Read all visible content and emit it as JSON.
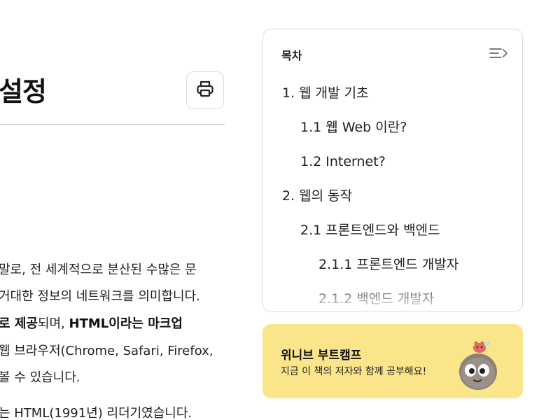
{
  "article": {
    "title": "설정",
    "print_icon": "printer-icon",
    "paragraph_lines": [
      "말로, 전 세계적으로 분산된 수많은 문",
      "거대한 정보의 네트워크를 의미합니다.",
      "로 제공",
      "되며, ",
      "HTML이라는 마크업",
      "웹 브라우저(Chrome, Safari, Firefox,",
      "볼 수 있습니다.",
      "는 HTML(1991년) 리더기였습니다."
    ]
  },
  "toc": {
    "title": "목차",
    "collapse_icon": "toc-collapse-icon",
    "items": [
      "1. 웹 개발 기초",
      "1.1 웹 Web 이란?",
      "1.2 Internet?",
      "2. 웹의 동작",
      "2.1 프론트엔드와 백엔드",
      "2.1.1 프론트엔드 개발자",
      "2.1.2 백엔드 개발자"
    ]
  },
  "promo": {
    "title": "위니브 부트캠프",
    "subtitle": "지금 이 책의 저자와 함께 공부해요!",
    "mascot_icon": "mascot-character-icon",
    "background": "#fbe58b"
  }
}
